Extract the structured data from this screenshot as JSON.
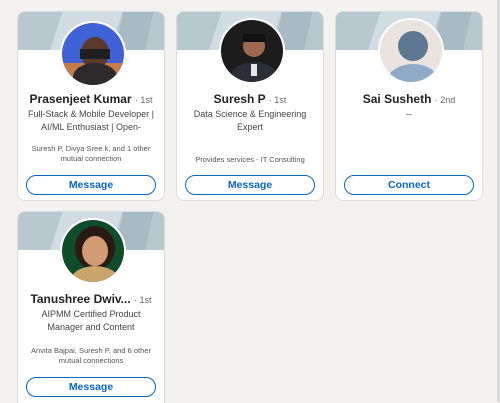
{
  "connections": [
    {
      "name": "Prasenjeet Kumar",
      "degree": "· 1st",
      "headline": "Full-Stack & Mobile Developer | AI/ML Enthusiast | Open-Source...",
      "mutual": "Suresh P, Divya Sree k, and 1 other mutual connection",
      "action": "Message"
    },
    {
      "name": "Suresh P",
      "degree": "· 1st",
      "headline": "Data Science & Engineering Expert",
      "mutual": "Provides services - IT Consulting",
      "action": "Message"
    },
    {
      "name": "Sai Susheth",
      "degree": "· 2nd",
      "headline": "--",
      "mutual": "",
      "action": "Connect"
    },
    {
      "name": "Tanushree Dwiv...",
      "degree": "· 1st",
      "headline": "AIPMM Certified Product Manager and Content Marketin...",
      "mutual": "Anvita Bajpai, Suresh P, and 6 other mutual connections",
      "action": "Message"
    }
  ],
  "colors": {
    "accent": "#0a66c2",
    "banner": "#b7c8cf",
    "page_bg": "#f3f2ef"
  }
}
